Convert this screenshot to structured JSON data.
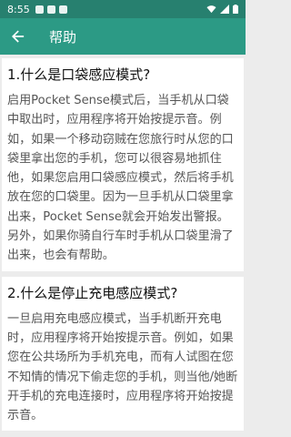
{
  "status_bar": {
    "time": "8:55",
    "notification_icons": [
      "notification-icon-1",
      "notification-icon-2",
      "notification-icon-3"
    ],
    "right_icons": [
      "wifi-icon",
      "signal-icon",
      "battery-icon"
    ]
  },
  "app_bar": {
    "title": "帮助",
    "back_icon": "arrow-back-icon"
  },
  "sections": [
    {
      "title": "1.什么是口袋感应模式?",
      "body": "启用Pocket Sense模式后，当手机从口袋中取出时，应用程序将开始按提示音。例如，如果一个移动窃贼在您旅行时从您的口袋里拿出您的手机，您可以很容易地抓住他，如果您启用口袋感应模式，然后将手机放在您的口袋里。因为一旦手机从口袋里拿出来，Pocket Sense就会开始发出警报。另外，如果你骑自行车时手机从口袋里滑了出来，也会有帮助。"
    },
    {
      "title": "2.什么是停止充电感应模式?",
      "body": "一旦启用充电感应模式，当手机断开充电时，应用程序将开始按提示音。例如，如果您在公共场所为手机充电，而有人试图在您不知情的情况下偷走您的手机，则当他/她断开手机的充电连接时，应用程序将开始按提示音。"
    }
  ]
}
